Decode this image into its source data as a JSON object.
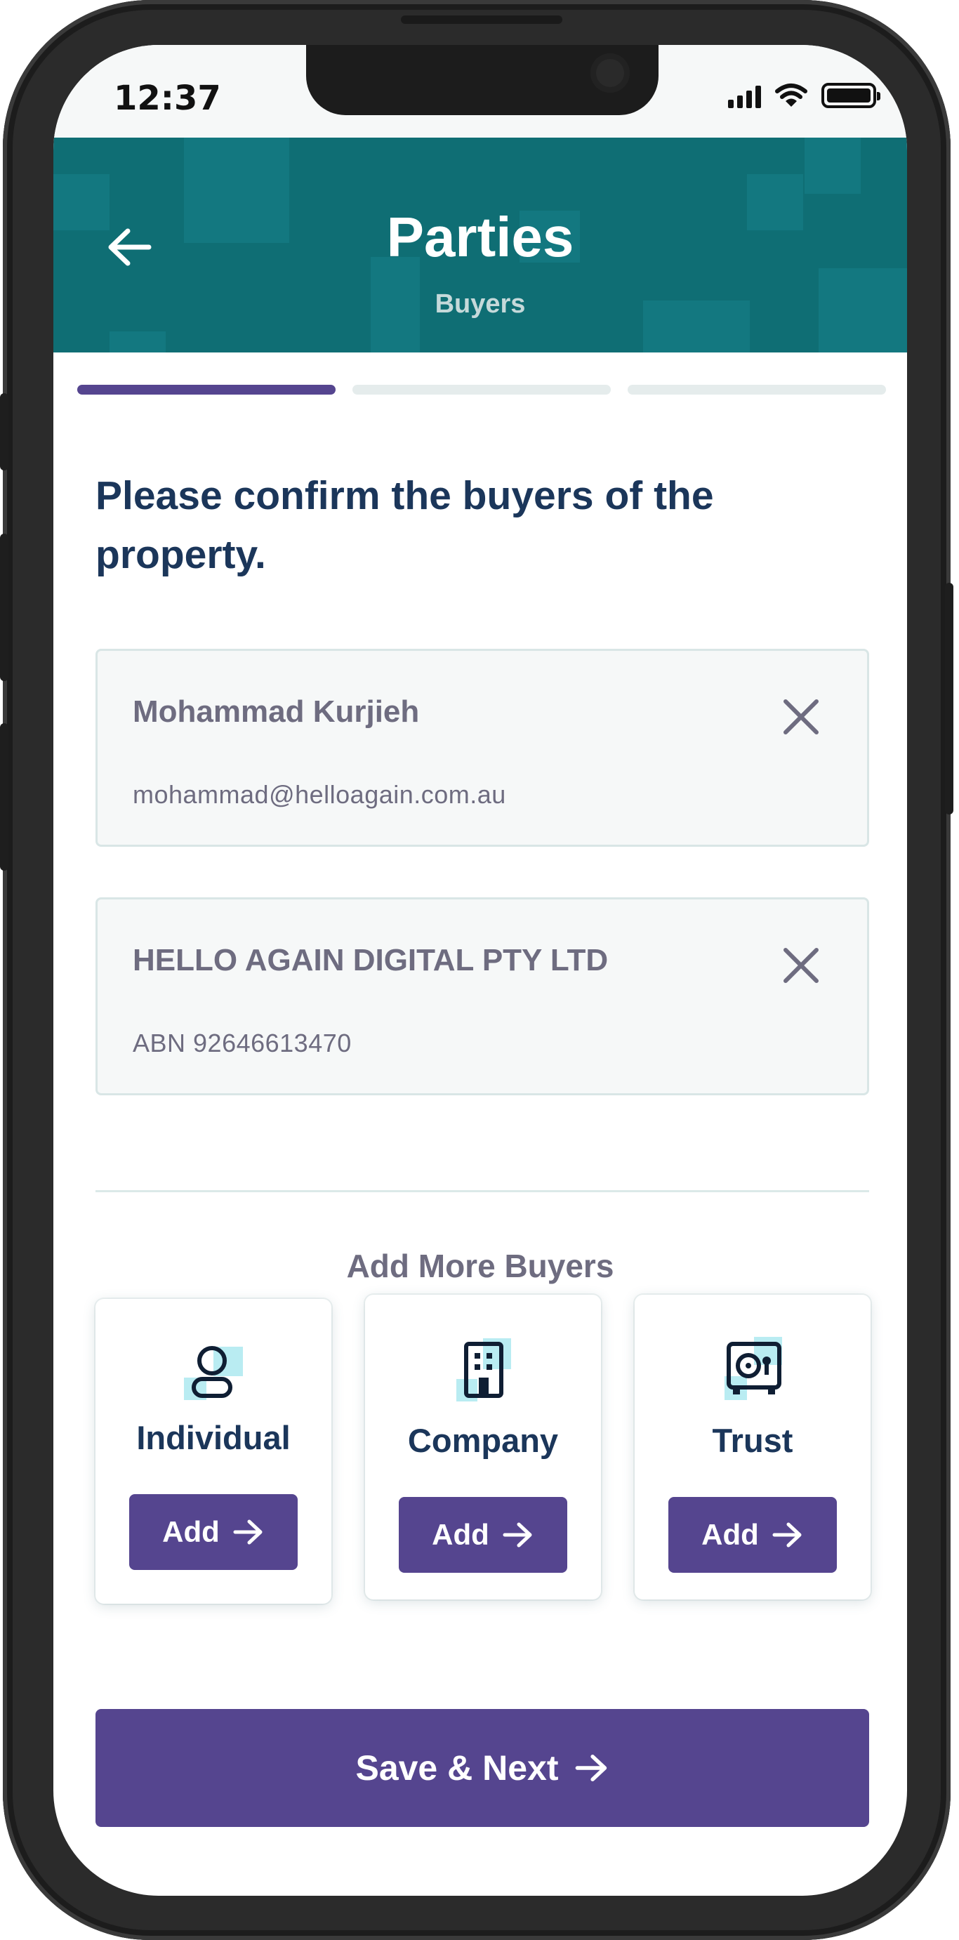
{
  "status_bar": {
    "time": "12:37"
  },
  "header": {
    "title": "Parties",
    "subtitle": "Buyers"
  },
  "progress": {
    "steps_total": 3,
    "current_step": 1
  },
  "question": "Please confirm the buyers of the property.",
  "buyers": [
    {
      "name": "Mohammad Kurjieh",
      "detail": "mohammad@helloagain.com.au"
    },
    {
      "name": "HELLO AGAIN DIGITAL PTY LTD",
      "detail": "ABN 92646613470"
    }
  ],
  "add_more": {
    "heading": "Add More Buyers",
    "types": [
      {
        "label": "Individual",
        "button": "Add",
        "icon": "person-icon"
      },
      {
        "label": "Company",
        "button": "Add",
        "icon": "building-icon"
      },
      {
        "label": "Trust",
        "button": "Add",
        "icon": "safe-icon"
      }
    ]
  },
  "footer": {
    "save_label": "Save & Next"
  },
  "colors": {
    "header_bg": "#0f6e74",
    "accent": "#55458f",
    "heading_text": "#1b365a",
    "muted_text": "#6e6c80",
    "icon_highlight": "#b9ecf2"
  }
}
